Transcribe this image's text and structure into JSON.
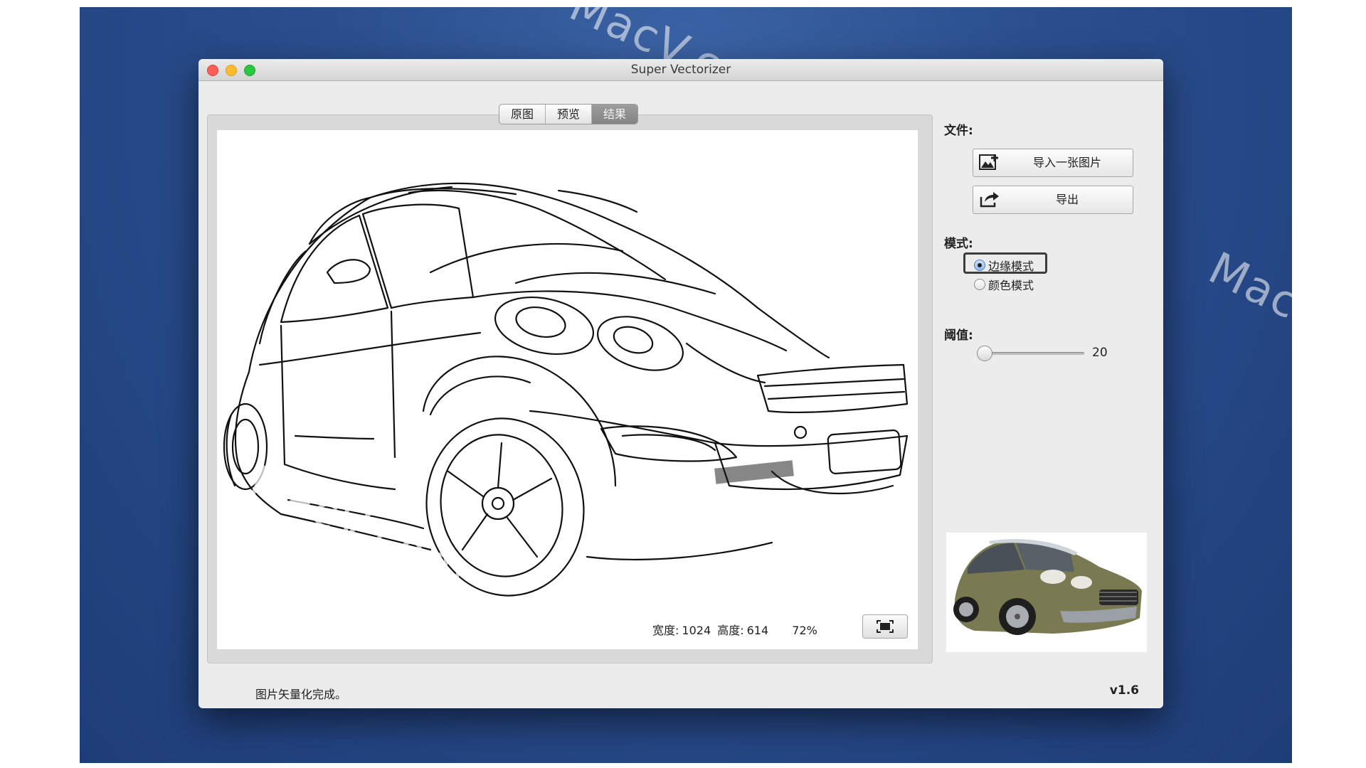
{
  "watermarks": [
    "MacV.com",
    "MacV.com",
    "MacV.com"
  ],
  "window": {
    "title": "Super Vectorizer"
  },
  "tabs": [
    {
      "label": "原图",
      "active": false
    },
    {
      "label": "预览",
      "active": false
    },
    {
      "label": "结果",
      "active": true
    }
  ],
  "canvas": {
    "width_label": "宽度:",
    "width_value": "1024",
    "height_label": "高度:",
    "height_value": "614",
    "zoom": "72%",
    "fit_icon": "fit-to-window-icon"
  },
  "sidebar": {
    "file_label": "文件:",
    "import_button": "导入一张图片",
    "import_icon": "import-image-icon",
    "export_button": "导出",
    "export_icon": "export-share-icon",
    "mode_label": "模式:",
    "modes": [
      {
        "label": "边缘模式",
        "selected": true
      },
      {
        "label": "颜色模式",
        "selected": false
      }
    ],
    "threshold_label": "阈值:",
    "threshold_value": "20"
  },
  "status_text": "图片矢量化完成。",
  "version": "v1.6",
  "colors": {
    "background": "#2b4f8f",
    "tab_active": "#8c8c8c",
    "car_color": "#7a7a52"
  }
}
